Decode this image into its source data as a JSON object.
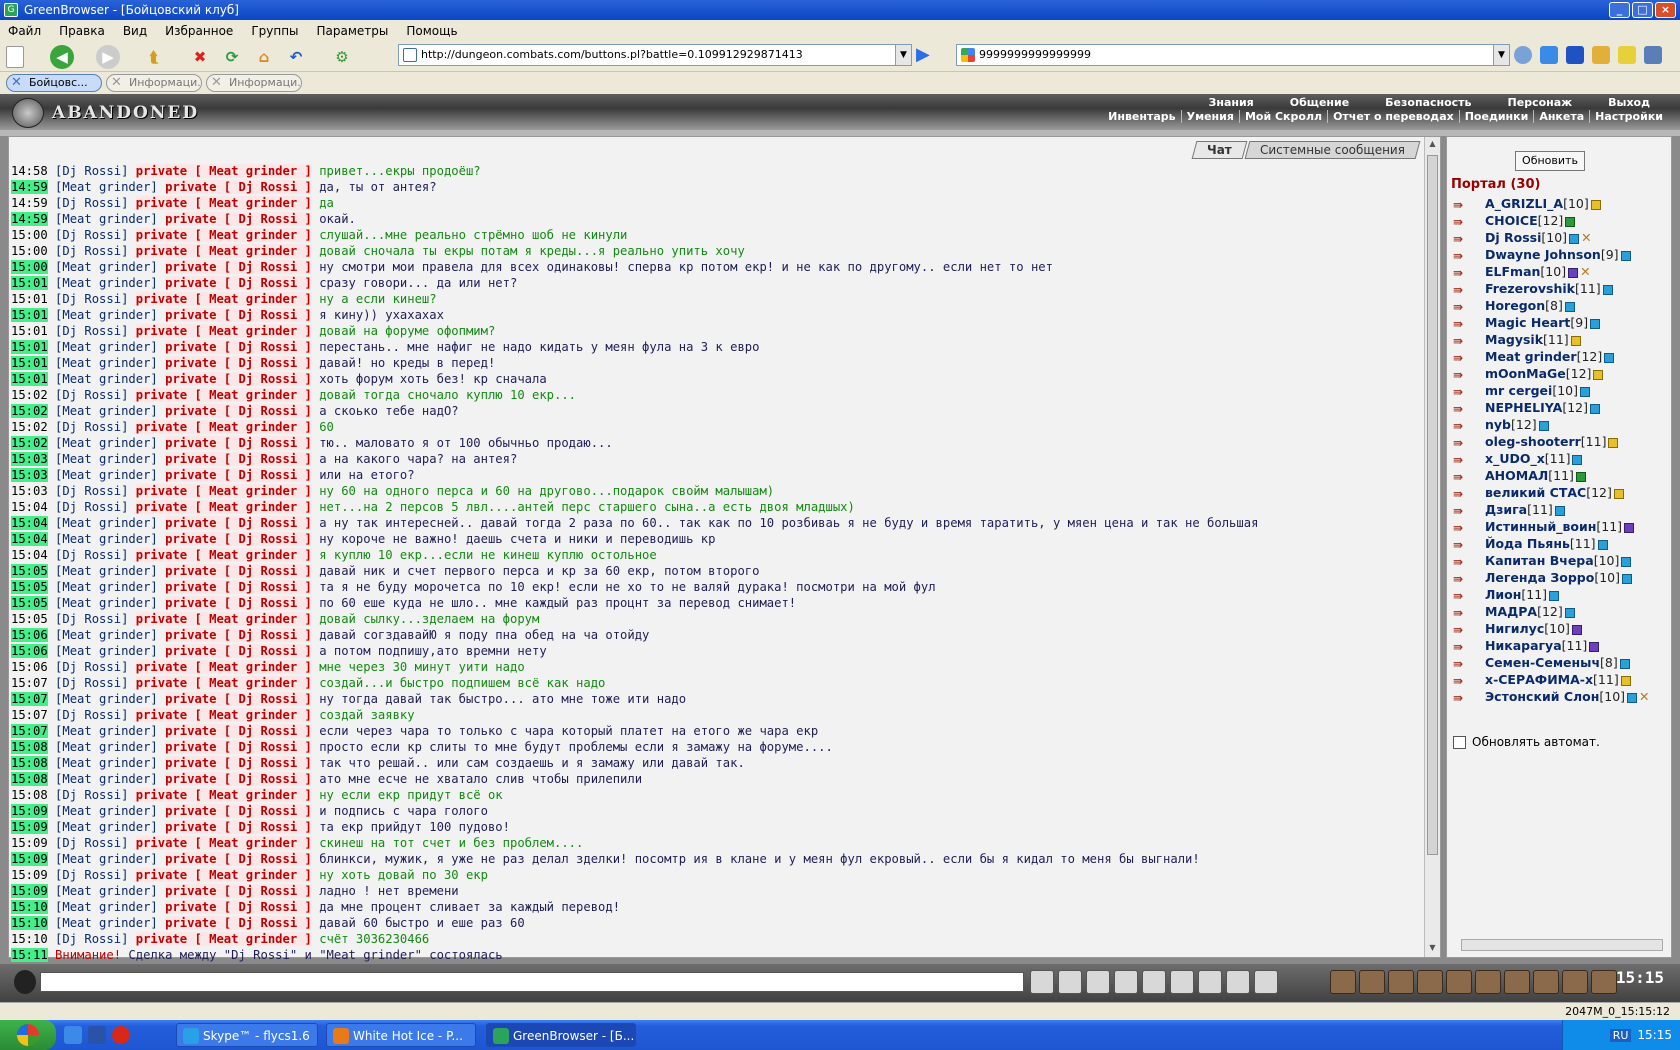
{
  "window": {
    "title": "GreenBrowser - [Бойцовский клуб]"
  },
  "menu": [
    "Файл",
    "Правка",
    "Вид",
    "Избранное",
    "Группы",
    "Параметры",
    "Помощь"
  ],
  "address": {
    "url": "http://dungeon.combats.com/buttons.pl?battle=0.109912929871413"
  },
  "search": {
    "value": "9999999999999999"
  },
  "tabs": [
    {
      "label": "Бойцовс...",
      "active": true
    },
    {
      "label": "Информаци...",
      "active": false
    },
    {
      "label": "Информаци...",
      "active": false
    }
  ],
  "game": {
    "logo": "ABANDONED PLAIN",
    "nav_top": [
      "Знания",
      "Общение",
      "Безопасность",
      "Персонаж",
      "Выход"
    ],
    "nav_bottom": [
      "Инвентарь",
      "Умения",
      "Мой Скролл",
      "Отчет о переводах",
      "Поединки",
      "Анкета",
      "Настройки"
    ],
    "chat_tabs": [
      "Чат",
      "Системные сообщения"
    ],
    "refresh_label": "Обновить",
    "portal_label": "Портал (30)",
    "auto_update_label": "Обновлять автомат.",
    "clock": "15:15"
  },
  "messages": [
    {
      "time": "14:58",
      "hl": false,
      "from": "[Dj Rossi]",
      "to": "private [ Meat grinder ]",
      "text": "привет...екры продоёш?",
      "mine": false
    },
    {
      "time": "14:59",
      "hl": true,
      "from": "[Meat grinder]",
      "to": "private [ Dj Rossi ]",
      "text": "да, ты от антея?",
      "mine": true
    },
    {
      "time": "14:59",
      "hl": false,
      "from": "[Dj Rossi]",
      "to": "private [ Meat grinder ]",
      "text": "да",
      "mine": false
    },
    {
      "time": "14:59",
      "hl": true,
      "from": "[Meat grinder]",
      "to": "private [ Dj Rossi ]",
      "text": "окай.",
      "mine": true
    },
    {
      "time": "15:00",
      "hl": false,
      "from": "[Dj Rossi]",
      "to": "private [ Meat grinder ]",
      "text": "слушай...мне реально стрёмно шоб не кинули",
      "mine": false
    },
    {
      "time": "15:00",
      "hl": false,
      "from": "[Dj Rossi]",
      "to": "private [ Meat grinder ]",
      "text": "довай сночала ты екры потам я креды...я реально упить хочу",
      "mine": false
    },
    {
      "time": "15:00",
      "hl": true,
      "from": "[Meat grinder]",
      "to": "private [ Dj Rossi ]",
      "text": "ну смотри мои правела для всех одинаковы! сперва кр потом екр! и не как по другому.. если нет то нет",
      "mine": true
    },
    {
      "time": "15:01",
      "hl": true,
      "from": "[Meat grinder]",
      "to": "private [ Dj Rossi ]",
      "text": "сразу говори... да или нет?",
      "mine": true
    },
    {
      "time": "15:01",
      "hl": false,
      "from": "[Dj Rossi]",
      "to": "private [ Meat grinder ]",
      "text": "ну а если кинеш?",
      "mine": false
    },
    {
      "time": "15:01",
      "hl": true,
      "from": "[Meat grinder]",
      "to": "private [ Dj Rossi ]",
      "text": "я кину)) ухахахах",
      "mine": true
    },
    {
      "time": "15:01",
      "hl": false,
      "from": "[Dj Rossi]",
      "to": "private [ Meat grinder ]",
      "text": "довай на форуме офопмим?",
      "mine": false
    },
    {
      "time": "15:01",
      "hl": true,
      "from": "[Meat grinder]",
      "to": "private [ Dj Rossi ]",
      "text": "перестань.. мне нафиг не надо кидать у меян фула на 3 к евро",
      "mine": true
    },
    {
      "time": "15:01",
      "hl": true,
      "from": "[Meat grinder]",
      "to": "private [ Dj Rossi ]",
      "text": "давай! но креды в перед!",
      "mine": true
    },
    {
      "time": "15:01",
      "hl": true,
      "from": "[Meat grinder]",
      "to": "private [ Dj Rossi ]",
      "text": "хоть форум хоть без! кр сначала",
      "mine": true
    },
    {
      "time": "15:02",
      "hl": false,
      "from": "[Dj Rossi]",
      "to": "private [ Meat grinder ]",
      "text": "довай тогда сночало куплю 10 екр...",
      "mine": false
    },
    {
      "time": "15:02",
      "hl": true,
      "from": "[Meat grinder]",
      "to": "private [ Dj Rossi ]",
      "text": "а скоько тебе надО?",
      "mine": true
    },
    {
      "time": "15:02",
      "hl": false,
      "from": "[Dj Rossi]",
      "to": "private [ Meat grinder ]",
      "text": "60",
      "mine": false
    },
    {
      "time": "15:02",
      "hl": true,
      "from": "[Meat grinder]",
      "to": "private [ Dj Rossi ]",
      "text": "тю.. маловато я от 100 обычньо продаю...",
      "mine": true
    },
    {
      "time": "15:03",
      "hl": true,
      "from": "[Meat grinder]",
      "to": "private [ Dj Rossi ]",
      "text": "а на какого чара? на антея?",
      "mine": true
    },
    {
      "time": "15:03",
      "hl": true,
      "from": "[Meat grinder]",
      "to": "private [ Dj Rossi ]",
      "text": "или на етого?",
      "mine": true
    },
    {
      "time": "15:03",
      "hl": false,
      "from": "[Dj Rossi]",
      "to": "private [ Meat grinder ]",
      "text": "ну 60 на одного перса и 60 на другово...подарок свойм малышам)",
      "mine": false
    },
    {
      "time": "15:04",
      "hl": false,
      "from": "[Dj Rossi]",
      "to": "private [ Meat grinder ]",
      "text": "нет...на 2 персов 5 лвл....антей перс старшего сына..а есть двоя младшых)",
      "mine": false
    },
    {
      "time": "15:04",
      "hl": true,
      "from": "[Meat grinder]",
      "to": "private [ Dj Rossi ]",
      "text": "а ну так интересней.. давай тогда 2 раза по 60.. так как по 10 розбиваь я не буду и время таратить, у мяен цена и так не большая",
      "mine": true
    },
    {
      "time": "15:04",
      "hl": true,
      "from": "[Meat grinder]",
      "to": "private [ Dj Rossi ]",
      "text": "ну короче не важно! даешь счета и ники и переводишь кр",
      "mine": true
    },
    {
      "time": "15:04",
      "hl": false,
      "from": "[Dj Rossi]",
      "to": "private [ Meat grinder ]",
      "text": "я куплю 10 екр...если не кинеш куплю остольное",
      "mine": false
    },
    {
      "time": "15:05",
      "hl": true,
      "from": "[Meat grinder]",
      "to": "private [ Dj Rossi ]",
      "text": "давай ник и счет первого перса и кр за 60 екр, потом второго",
      "mine": true
    },
    {
      "time": "15:05",
      "hl": true,
      "from": "[Meat grinder]",
      "to": "private [ Dj Rossi ]",
      "text": "та я не буду морочетса по 10 екр! если не хо то не валяй дурака! посмотри на мой фул",
      "mine": true
    },
    {
      "time": "15:05",
      "hl": true,
      "from": "[Meat grinder]",
      "to": "private [ Dj Rossi ]",
      "text": "по 60 еше куда не шло.. мне каждый раз процнт за перевод снимает!",
      "mine": true
    },
    {
      "time": "15:05",
      "hl": false,
      "from": "[Dj Rossi]",
      "to": "private [ Meat grinder ]",
      "text": "довай сылку...зделаем на форум",
      "mine": false
    },
    {
      "time": "15:06",
      "hl": true,
      "from": "[Meat grinder]",
      "to": "private [ Dj Rossi ]",
      "text": "давай согздавайЮ я поду пна обед на ча отойду",
      "mine": true
    },
    {
      "time": "15:06",
      "hl": true,
      "from": "[Meat grinder]",
      "to": "private [ Dj Rossi ]",
      "text": "а потом подпишу,ато времни нету",
      "mine": true
    },
    {
      "time": "15:06",
      "hl": false,
      "from": "[Dj Rossi]",
      "to": "private [ Meat grinder ]",
      "text": "мне через 30 минут уити надо",
      "mine": false
    },
    {
      "time": "15:07",
      "hl": false,
      "from": "[Dj Rossi]",
      "to": "private [ Meat grinder ]",
      "text": "создай...и быстро подпишем всё как надо",
      "mine": false
    },
    {
      "time": "15:07",
      "hl": true,
      "from": "[Meat grinder]",
      "to": "private [ Dj Rossi ]",
      "text": "ну тогда давай так быстро... ато мне тоже ити надо",
      "mine": true
    },
    {
      "time": "15:07",
      "hl": false,
      "from": "[Dj Rossi]",
      "to": "private [ Meat grinder ]",
      "text": "создай заявку",
      "mine": false
    },
    {
      "time": "15:07",
      "hl": true,
      "from": "[Meat grinder]",
      "to": "private [ Dj Rossi ]",
      "text": "если через чара то только с чара который платет на етого же чара екр",
      "mine": true
    },
    {
      "time": "15:08",
      "hl": true,
      "from": "[Meat grinder]",
      "to": "private [ Dj Rossi ]",
      "text": "просто если кр слиты то мне будут проблемы если я замажу на форуме....",
      "mine": true
    },
    {
      "time": "15:08",
      "hl": true,
      "from": "[Meat grinder]",
      "to": "private [ Dj Rossi ]",
      "text": "так что решай.. или сам создаешь и я замажу или давай так.",
      "mine": true
    },
    {
      "time": "15:08",
      "hl": true,
      "from": "[Meat grinder]",
      "to": "private [ Dj Rossi ]",
      "text": "ато мне есче не хватало слив чтобы прилепили",
      "mine": true
    },
    {
      "time": "15:08",
      "hl": false,
      "from": "[Dj Rossi]",
      "to": "private [ Meat grinder ]",
      "text": "ну если екр придут всё ок",
      "mine": false
    },
    {
      "time": "15:09",
      "hl": true,
      "from": "[Meat grinder]",
      "to": "private [ Dj Rossi ]",
      "text": "и подпись с чара голого",
      "mine": true
    },
    {
      "time": "15:09",
      "hl": true,
      "from": "[Meat grinder]",
      "to": "private [ Dj Rossi ]",
      "text": "та екр прийдут 100 пудово!",
      "mine": true
    },
    {
      "time": "15:09",
      "hl": false,
      "from": "[Dj Rossi]",
      "to": "private [ Meat grinder ]",
      "text": "скинеш на тот счет и без проблем....",
      "mine": false
    },
    {
      "time": "15:09",
      "hl": true,
      "from": "[Meat grinder]",
      "to": "private [ Dj Rossi ]",
      "text": "блинкси, мужик, я уже не раз делал зделки! посомтр ия в клане и у меян фул екровый.. если бы я кидал то меня бы выгнали!",
      "mine": true
    },
    {
      "time": "15:09",
      "hl": false,
      "from": "[Dj Rossi]",
      "to": "private [ Meat grinder ]",
      "text": "ну хоть довай по 30 екр",
      "mine": false
    },
    {
      "time": "15:09",
      "hl": true,
      "from": "[Meat grinder]",
      "to": "private [ Dj Rossi ]",
      "text": "ладно ! нет времени",
      "mine": true
    },
    {
      "time": "15:10",
      "hl": true,
      "from": "[Meat grinder]",
      "to": "private [ Dj Rossi ]",
      "text": "да мне процент сливает за каждый перевод!",
      "mine": true
    },
    {
      "time": "15:10",
      "hl": true,
      "from": "[Meat grinder]",
      "to": "private [ Dj Rossi ]",
      "text": "давай 60 быстро и еше раз 60",
      "mine": true
    },
    {
      "time": "15:10",
      "hl": false,
      "from": "[Dj Rossi]",
      "to": "private [ Meat grinder ]",
      "text": "счёт 3036230466",
      "mine": false
    }
  ],
  "system_message": {
    "time": "15:11",
    "label": "Внимание!",
    "text": "Сделка между \"Dj Rossi\" и \"Meat grinder\" состоялась"
  },
  "users": [
    {
      "name": "A_GRIZLI_A",
      "level": "[10]",
      "badge": "y",
      "extra": ""
    },
    {
      "name": "CHOICE",
      "level": "[12]",
      "badge": "g",
      "extra": ""
    },
    {
      "name": "Dj Rossi",
      "level": "[10]",
      "badge": "b",
      "extra": "✕"
    },
    {
      "name": "Dwayne Johnson",
      "level": "[9]",
      "badge": "b",
      "extra": ""
    },
    {
      "name": "ELFman",
      "level": "[10]",
      "badge": "p",
      "extra": "✕"
    },
    {
      "name": "Frezerovshik",
      "level": "[11]",
      "badge": "b",
      "extra": ""
    },
    {
      "name": "Horegon",
      "level": "[8]",
      "badge": "b",
      "extra": ""
    },
    {
      "name": "Magic Heart",
      "level": "[9]",
      "badge": "b",
      "extra": ""
    },
    {
      "name": "Magysik",
      "level": "[11]",
      "badge": "y",
      "extra": ""
    },
    {
      "name": "Meat grinder",
      "level": "[12]",
      "badge": "b",
      "extra": ""
    },
    {
      "name": "mOonMaGe",
      "level": "[12]",
      "badge": "y",
      "extra": ""
    },
    {
      "name": "mr cergei",
      "level": "[10]",
      "badge": "b",
      "extra": ""
    },
    {
      "name": "NEPHELIYA",
      "level": "[12]",
      "badge": "b",
      "extra": ""
    },
    {
      "name": "nyb",
      "level": "[12]",
      "badge": "b",
      "extra": ""
    },
    {
      "name": "oleg-shooterr",
      "level": "[11]",
      "badge": "y",
      "extra": ""
    },
    {
      "name": "x_UDO_x",
      "level": "[11]",
      "badge": "b",
      "extra": ""
    },
    {
      "name": "АНОМАЛ",
      "level": "[11]",
      "badge": "g",
      "extra": ""
    },
    {
      "name": "великий СТАС",
      "level": "[12]",
      "badge": "y",
      "extra": ""
    },
    {
      "name": "Дзига",
      "level": "[11]",
      "badge": "b",
      "extra": ""
    },
    {
      "name": "Истинный_воин",
      "level": "[11]",
      "badge": "p",
      "extra": ""
    },
    {
      "name": "Йода Пьянь",
      "level": "[11]",
      "badge": "b",
      "extra": ""
    },
    {
      "name": "Капитан Вчера",
      "level": "[10]",
      "badge": "b",
      "extra": ""
    },
    {
      "name": "Легенда Зорро",
      "level": "[10]",
      "badge": "b",
      "extra": ""
    },
    {
      "name": "Лион",
      "level": "[11]",
      "badge": "b",
      "extra": ""
    },
    {
      "name": "МАДРА",
      "level": "[12]",
      "badge": "b",
      "extra": ""
    },
    {
      "name": "Нигилус",
      "level": "[10]",
      "badge": "p",
      "extra": ""
    },
    {
      "name": "Никарагуа",
      "level": "[11]",
      "badge": "p",
      "extra": ""
    },
    {
      "name": "Семен-Семеныч",
      "level": "[8]",
      "badge": "b",
      "extra": ""
    },
    {
      "name": "х-СЕРАФИМА-х",
      "level": "[11]",
      "badge": "y",
      "extra": ""
    },
    {
      "name": "Эстонский Слон",
      "level": "[10]",
      "badge": "b",
      "extra": "✕"
    }
  ],
  "status": {
    "right": "2047M_0_15:15:12"
  },
  "taskbar": {
    "tasks": [
      "Skype™ - flycs1.6",
      "White Hot Ice - P...",
      "GreenBrowser - [Б..."
    ],
    "lang": "RU",
    "time": "15:15"
  }
}
